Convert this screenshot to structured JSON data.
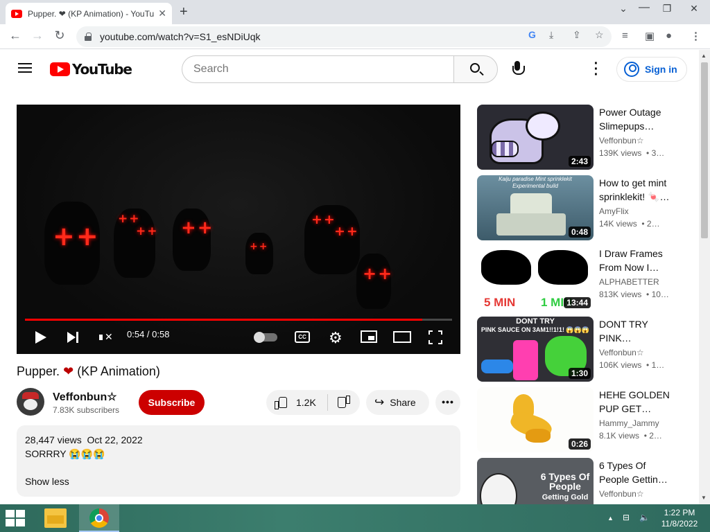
{
  "browser": {
    "tab_title": "Pupper. ❤ (KP Animation) - YouTube",
    "tab_close": "✕",
    "new_tab": "+",
    "url": "youtube.com/watch?v=S1_esNDiUqk",
    "window_controls": {
      "minimize": "⌄",
      "maximize": "🗗",
      "close": "✕"
    }
  },
  "youtube": {
    "logo_text": "YouTube",
    "search_placeholder": "Search",
    "sign_in": "Sign in"
  },
  "player": {
    "current_time": "0:54",
    "separator": " / ",
    "duration": "0:58",
    "progress_fraction": 0.93,
    "cc_label": "CC"
  },
  "video": {
    "title": "Pupper.",
    "title_heart": "❤",
    "title_suffix": "(KP Animation)",
    "channel_name": "Veffonbun☆",
    "subscribers": "7.83K subscribers",
    "subscribe_label": "Subscribe",
    "likes": "1.2K",
    "share_label": "Share",
    "more_label": "•••",
    "views": "28,447 views",
    "date": "Oct 22, 2022",
    "description": "SORRRY 😭😭😭",
    "show_less": "Show less"
  },
  "recommendations": [
    {
      "title": "Power Outage Slimepups…",
      "channel": "Veffonbun☆",
      "views": "139K views",
      "age": "3…",
      "duration": "2:43"
    },
    {
      "title": "How to get mint sprinklekit! 🍬…",
      "channel": "AmyFlix",
      "views": "14K views",
      "age": "2…",
      "duration": "0:48",
      "overlay_line1": "Kaiju paradise Mint sprinklekit",
      "overlay_line2": "Experimental build"
    },
    {
      "title": "I Draw Frames From Now I…",
      "channel": "ALPHABETTER",
      "views": "813K views",
      "age": "10…",
      "duration": "13:44",
      "overlay_left": "5 MIN",
      "overlay_right": "1 MIN"
    },
    {
      "title": "DONT TRY PINK…",
      "channel": "Veffonbun☆",
      "views": "106K views",
      "age": "1…",
      "duration": "1:30",
      "overlay_line1": "DONT TRY",
      "overlay_line2": "PINK SAUCE ON 3AM1!!1!1! 😱😱😱"
    },
    {
      "title": "HEHE GOLDEN PUP GET…",
      "channel": "Hammy_Jammy",
      "views": "8.1K views",
      "age": "2…",
      "duration": "0:26"
    },
    {
      "title": "6 Types Of People Gettin…",
      "channel": "Veffonbun☆",
      "views": "",
      "age": "",
      "duration": "",
      "overlay_line1": "6 Types Of",
      "overlay_line2": "People",
      "overlay_line3": "Getting Gold"
    }
  ],
  "taskbar": {
    "time": "1:22 PM",
    "date": "11/8/2022",
    "tray_arrow": "▲"
  },
  "colors": {
    "youtube_red": "#ff0000",
    "subscribe_red": "#cc0000",
    "link_blue": "#065fd4",
    "eye_red": "#ff2a1a"
  }
}
